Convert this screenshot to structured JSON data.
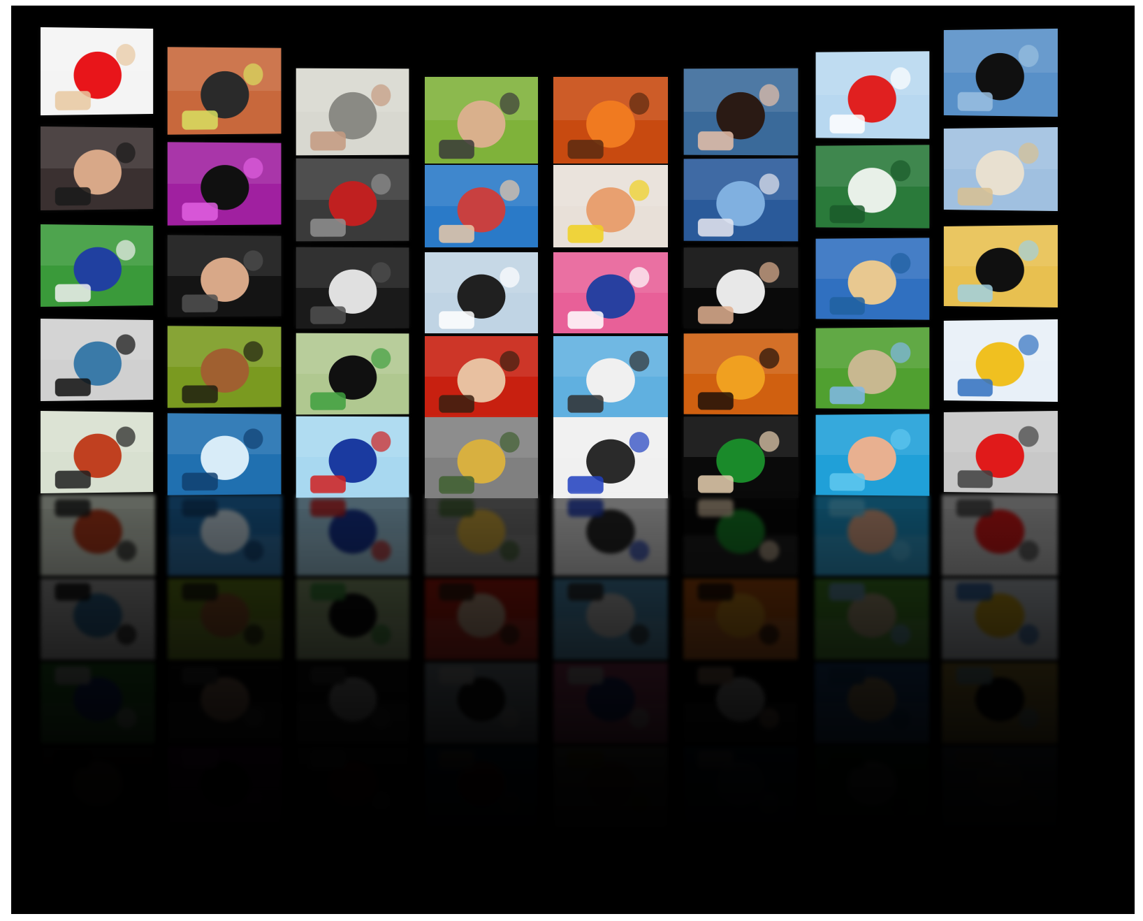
{
  "scene": {
    "background": "#000000",
    "rows": 5,
    "columns": 8
  },
  "tiles": [
    {
      "icon": "woman-with-red-ball",
      "bg": "#f4f4f4",
      "fg": "#e8151a",
      "accent": "#e8c8a0"
    },
    {
      "icon": "tennis-court",
      "bg": "#c8683c",
      "fg": "#2a2a2a",
      "accent": "#d8e060"
    },
    {
      "icon": "man-reading-newspaper",
      "bg": "#d8d8d0",
      "fg": "#8a8a84",
      "accent": "#c49a80"
    },
    {
      "icon": "couple-lying-grass",
      "bg": "#7fb23a",
      "fg": "#d9b08c",
      "accent": "#3a3a3a"
    },
    {
      "icon": "goldfish",
      "bg": "#c84a10",
      "fg": "#f07a20",
      "accent": "#5a2a10"
    },
    {
      "icon": "woman-portrait-lake",
      "bg": "#3a6a9a",
      "fg": "#2a1a14",
      "accent": "#e8c0a8"
    },
    {
      "icon": "airplanes-in-sky",
      "bg": "#b8d8f0",
      "fg": "#e02020",
      "accent": "#ffffff"
    },
    {
      "icon": "people-jumping-pier",
      "bg": "#5890c8",
      "fg": "#101010",
      "accent": "#9ac0e0"
    },
    {
      "icon": "three-friends-faces",
      "bg": "#3a3030",
      "fg": "#d8a888",
      "accent": "#1a1a1a"
    },
    {
      "icon": "dancer-purple-light",
      "bg": "#a020a0",
      "fg": "#101010",
      "accent": "#e060e0"
    },
    {
      "icon": "child-covering-head",
      "bg": "#3a3a3a",
      "fg": "#c02020",
      "accent": "#909090"
    },
    {
      "icon": "friends-on-jetty",
      "bg": "#2a7ac8",
      "fg": "#c84040",
      "accent": "#e8c8a8"
    },
    {
      "icon": "mother-child-desk",
      "bg": "#e8e0d8",
      "fg": "#e8a070",
      "accent": "#f0d020"
    },
    {
      "icon": "lake-mountains",
      "bg": "#2a5a9a",
      "fg": "#80b0e0",
      "accent": "#e8e8f0"
    },
    {
      "icon": "chalkboard-emc2",
      "bg": "#2a7a3a",
      "fg": "#e8f0e8",
      "accent": "#1a5a2a"
    },
    {
      "icon": "village-street-dog",
      "bg": "#a0c0e0",
      "fg": "#e8e0d0",
      "accent": "#d8c090"
    },
    {
      "icon": "soccer-players-legs",
      "bg": "#3a9a3a",
      "fg": "#2040a0",
      "accent": "#f0f0f0"
    },
    {
      "icon": "woman-lying-dark",
      "bg": "#141414",
      "fg": "#d8a888",
      "accent": "#505050"
    },
    {
      "icon": "concert-crowd-lights",
      "bg": "#1a1a1a",
      "fg": "#e0e0e0",
      "accent": "#505050"
    },
    {
      "icon": "basketball-hoop",
      "bg": "#c0d4e4",
      "fg": "#202020",
      "accent": "#ffffff"
    },
    {
      "icon": "film-reel-pink",
      "bg": "#e86098",
      "fg": "#2840a0",
      "accent": "#ffffff"
    },
    {
      "icon": "woman-white-shirt",
      "bg": "#0a0a0a",
      "fg": "#e8e8e8",
      "accent": "#e0b090"
    },
    {
      "icon": "harbor-town",
      "bg": "#3070c0",
      "fg": "#e8c890",
      "accent": "#2060a0"
    },
    {
      "icon": "singer-microphone",
      "bg": "#e8c050",
      "fg": "#101010",
      "accent": "#a0d0e0"
    },
    {
      "icon": "blue-eye-closeup",
      "bg": "#d0d0d0",
      "fg": "#3a7aa8",
      "accent": "#101010"
    },
    {
      "icon": "forest-crowd",
      "bg": "#7a9a20",
      "fg": "#a06030",
      "accent": "#202010"
    },
    {
      "icon": "city-skyline-flying-man",
      "bg": "#b0c890",
      "fg": "#101010",
      "accent": "#40a040"
    },
    {
      "icon": "smiling-man-red-hood",
      "bg": "#c82010",
      "fg": "#e8c0a0",
      "accent": "#3a2010"
    },
    {
      "icon": "seagull-sky",
      "bg": "#60b0e0",
      "fg": "#f0f0f0",
      "accent": "#303030"
    },
    {
      "icon": "concert-hands-orange",
      "bg": "#d06010",
      "fg": "#f0a020",
      "accent": "#201008"
    },
    {
      "icon": "green-field-fence",
      "bg": "#50a030",
      "fg": "#c8b890",
      "accent": "#80b8e8"
    },
    {
      "icon": "snow-jump-yellow",
      "bg": "#e8f0f8",
      "fg": "#f0c020",
      "accent": "#3070c0"
    },
    {
      "icon": "kendo-mask",
      "bg": "#d8e0d0",
      "fg": "#c04020",
      "accent": "#202020"
    },
    {
      "icon": "ice-wave-blue",
      "bg": "#2070b0",
      "fg": "#d8ecf8",
      "accent": "#104070"
    },
    {
      "icon": "hands-keyboard-graph",
      "bg": "#a8d8f0",
      "fg": "#1a3aa0",
      "accent": "#d02020"
    },
    {
      "icon": "highway-car",
      "bg": "#808080",
      "fg": "#d8b040",
      "accent": "#406030"
    },
    {
      "icon": "skier-snow",
      "bg": "#f0f0f0",
      "fg": "#2a2a2a",
      "accent": "#2040c0"
    },
    {
      "icon": "twins-green-tug",
      "bg": "#0a0a0a",
      "fg": "#1a8a2a",
      "accent": "#e8d0b0"
    },
    {
      "icon": "swimmer-pool",
      "bg": "#20a0d8",
      "fg": "#e8b090",
      "accent": "#60c8f0"
    },
    {
      "icon": "red-lips-bw",
      "bg": "#c8c8c8",
      "fg": "#e01a1a",
      "accent": "#404040"
    }
  ]
}
